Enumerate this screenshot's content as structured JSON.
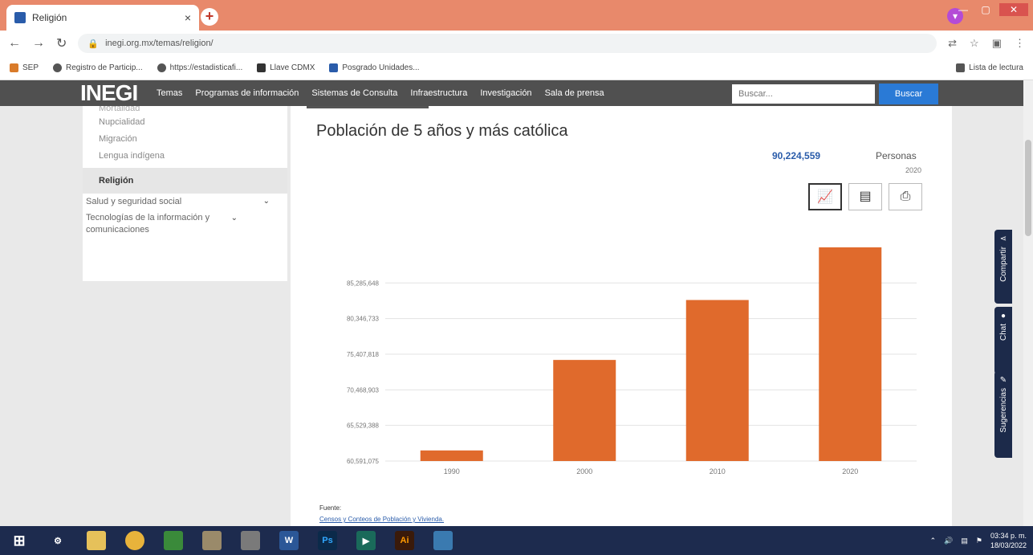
{
  "browser": {
    "tab_title": "Religión",
    "tab_close": "×",
    "new_tab": "+",
    "url": "inegi.org.mx/temas/religion/",
    "bookmarks": [
      "SEP",
      "Registro de Particip...",
      "https://estadisticaﬁ...",
      "Llave CDMX",
      "Posgrado Unidades..."
    ],
    "reading_list": "Lista de lectura"
  },
  "nav": {
    "logo": "INEGI",
    "items": [
      "Temas",
      "Programas de información",
      "Sistemas de Consulta",
      "Infraestructura",
      "Investigación",
      "Sala de prensa"
    ],
    "search_placeholder": "Buscar...",
    "search_button": "Buscar"
  },
  "sidebar": {
    "cut_item": "Mortalidad",
    "subitems": [
      "Nupcialidad",
      "Migración",
      "Lengua indígena"
    ],
    "active": "Religión",
    "categories": [
      "Salud y seguridad social",
      "Tecnologías de la información y comunicaciones"
    ]
  },
  "content": {
    "title": "Población de 5 años y más católica",
    "total_value": "90,224,559",
    "total_unit": "Personas",
    "total_year": "2020",
    "source_label": "Fuente:",
    "source_link": "Censos y Conteos de Población y Vivienda."
  },
  "chart_data": {
    "type": "bar",
    "categories": [
      "1990",
      "2000",
      "2010",
      "2020"
    ],
    "values": [
      62060000,
      74610000,
      82920000,
      90224559
    ],
    "ytick_labels": [
      "60,591,075",
      "65,529,388",
      "70,468,903",
      "75,407,818",
      "80,346,733",
      "85,285,648"
    ],
    "ylim": [
      60591075,
      92000000
    ],
    "color": "#e06a2c",
    "grid": true
  },
  "widgets": {
    "share": "Compartir",
    "chat": "Chat",
    "suggest": "Sugerencias"
  },
  "taskbar": {
    "apps": [
      "W",
      "Ps",
      "Ai"
    ],
    "time": "03:34 p. m.",
    "date": "18/03/2022"
  }
}
